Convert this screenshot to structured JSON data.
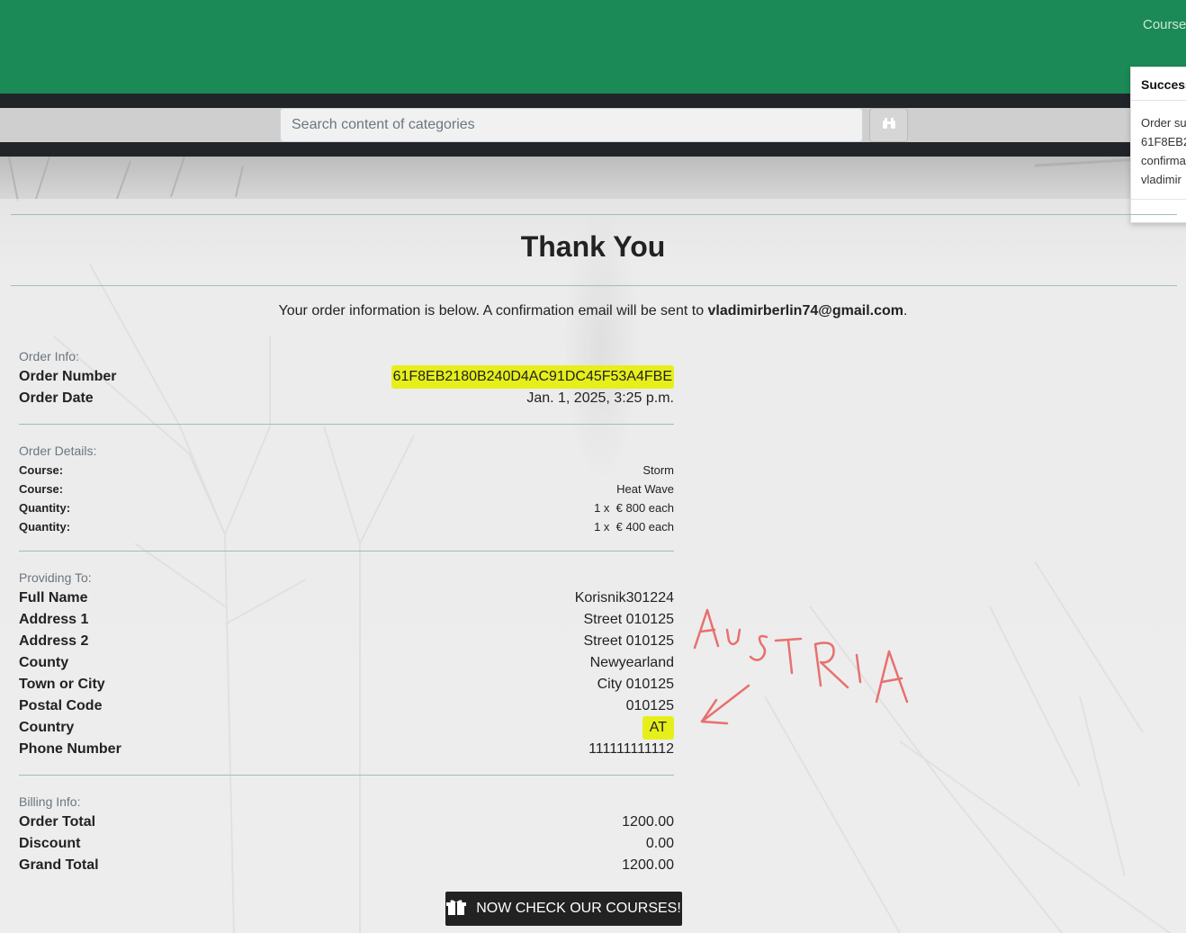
{
  "header": {
    "nav_link": "Course",
    "search_placeholder": "Search content of categories"
  },
  "toast": {
    "title": "Success",
    "lines": [
      "Order su",
      "61F8EB2",
      "confirma",
      "vladimir"
    ]
  },
  "page": {
    "title": "Thank You",
    "lead_prefix": "Your order information is below. A confirmation email will be sent to ",
    "email": "vladimirberlin74@gmail.com",
    "lead_suffix": "."
  },
  "order_info": {
    "label": "Order Info:",
    "order_number_key": "Order Number",
    "order_number": "61F8EB2180B240D4AC91DC45F53A4FBE",
    "order_date_key": "Order Date",
    "order_date": "Jan. 1, 2025, 3:25 p.m."
  },
  "order_details": {
    "label": "Order Details:",
    "rows": [
      {
        "key": "Course:",
        "value": "Storm"
      },
      {
        "key": "Course:",
        "value": "Heat Wave"
      },
      {
        "key": "Quantity:",
        "value": "1 x  € 800 each"
      },
      {
        "key": "Quantity:",
        "value": "1 x  € 400 each"
      }
    ]
  },
  "providing_to": {
    "label": "Providing To:",
    "rows": [
      {
        "key": "Full Name",
        "value": "Korisnik301224"
      },
      {
        "key": "Address 1",
        "value": "Street 010125"
      },
      {
        "key": "Address 2",
        "value": "Street 010125"
      },
      {
        "key": "County",
        "value": "Newyearland"
      },
      {
        "key": "Town or City",
        "value": "City 010125"
      },
      {
        "key": "Postal Code",
        "value": "010125"
      },
      {
        "key": "Country",
        "value": "AT"
      },
      {
        "key": "Phone Number",
        "value": "111111111112"
      }
    ]
  },
  "billing": {
    "label": "Billing Info:",
    "rows": [
      {
        "key": "Order Total",
        "value": "1200.00"
      },
      {
        "key": "Discount",
        "value": "0.00"
      },
      {
        "key": "Grand Total",
        "value": "1200.00"
      }
    ]
  },
  "cta": {
    "label": "NOW CHECK OUR COURSES!"
  },
  "annotation": {
    "handwritten_text": "AUSTRIA",
    "highlight_color": "#e6ef1a",
    "ink_color": "#e8706e"
  },
  "colors": {
    "topbar": "#1b8a57",
    "searchbar": "#212529"
  }
}
